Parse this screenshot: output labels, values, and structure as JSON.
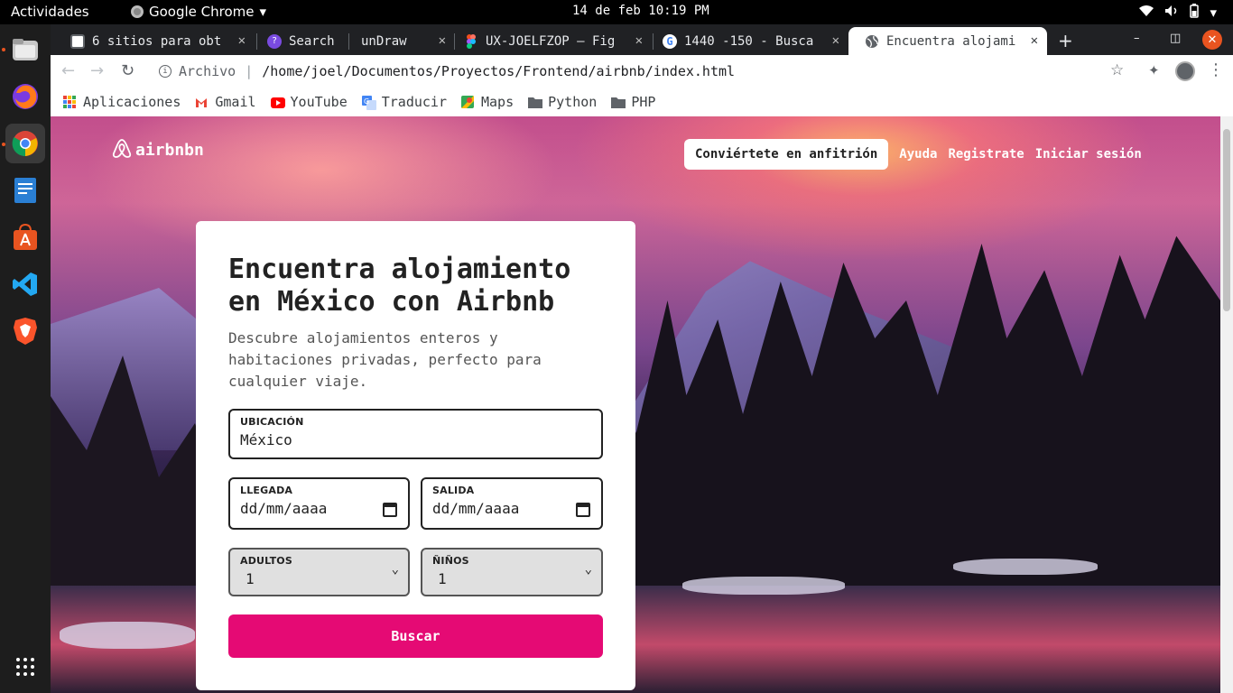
{
  "system": {
    "activities": "Actividades",
    "app_name": "Google Chrome",
    "clock": "14 de feb 10:19 PM"
  },
  "dock": {
    "items": [
      "files-icon",
      "firefox-icon",
      "chrome-icon",
      "text-editor-icon",
      "software-store-icon",
      "vscode-icon",
      "brave-icon",
      "apps-grid-icon"
    ]
  },
  "tabs": [
    {
      "title": "6 sitios para obt"
    },
    {
      "title": "Search"
    },
    {
      "title": "unDraw"
    },
    {
      "title": "UX-JOELFZOP – Fig"
    },
    {
      "title": "1440 -150 - Busca"
    },
    {
      "title": "Encuentra alojami"
    }
  ],
  "toolbar": {
    "security_label": "Archivo",
    "url": "/home/joel/Documentos/Proyectos/Frontend/airbnb/index.html"
  },
  "bookmarks": [
    "Aplicaciones",
    "Gmail",
    "YouTube",
    "Traducir",
    "Maps",
    "Python",
    "PHP"
  ],
  "header": {
    "logo_text": "airbnbn",
    "host_button": "Conviértete en anfitrión",
    "help": "Ayuda",
    "register": "Registrate",
    "login": "Iniciar sesión"
  },
  "form": {
    "title": "Encuentra alojamiento en México con Airbnb",
    "description": "Descubre alojamientos enteros y habitaciones privadas, perfecto para cualquier viaje.",
    "location_label": "UBICACIÓN",
    "location_value": "México",
    "arrival_label": "LLEGADA",
    "arrival_value": "dd/mm/aaaa",
    "departure_label": "SALIDA",
    "departure_value": "dd/mm/aaaa",
    "adults_label": "ADULTOS",
    "adults_value": "1",
    "children_label": "ÑIÑOS",
    "children_value": "1",
    "submit": "Buscar"
  },
  "colors": {
    "brand": "#e50a74",
    "ubuntu_accent": "#e95420"
  }
}
